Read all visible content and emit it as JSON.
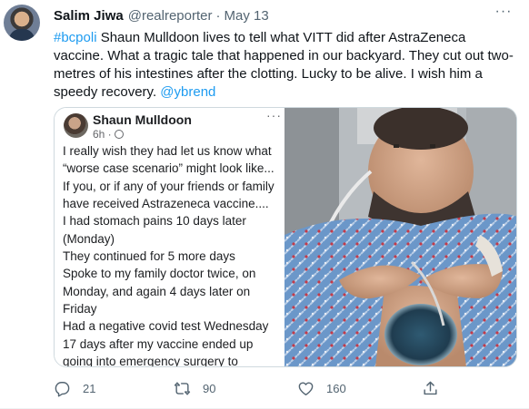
{
  "tweet": {
    "author_name": "Salim Jiwa",
    "author_handle": "@realreporter",
    "separator": "·",
    "date": "May 13",
    "more_label": "···",
    "text_hashtag": "#bcpoli",
    "text_body": " Shaun Mulldoon lives to tell what VITT did after AstraZeneca vaccine. What a tragic tale that happened in our backyard. They cut out two-metres of his intestines after the clotting. Lucky to be alive.  I wish him a speedy recovery. ",
    "text_mention": "@ybrend"
  },
  "media": {
    "post_author": "Shaun Mulldoon",
    "post_time": "6h ·",
    "post_more": "···",
    "post_lines": [
      "I really wish they had let us know what",
      "“worse case scenario” might look like...",
      "If you, or if any of your friends or family",
      "have received Astrazeneca vaccine....",
      "I had stomach pains 10 days later",
      "(Monday)",
      "They continued for 5 more days",
      "Spoke to my family doctor twice, on",
      "Monday, and again 4 days later on",
      "Friday",
      "Had a negative covid test Wednesday",
      "17 days after my vaccine ended up",
      "going into emergency surgery to"
    ]
  },
  "actions": {
    "reply_count": "21",
    "retweet_count": "90",
    "like_count": "160",
    "icons": [
      "reply-icon",
      "retweet-icon",
      "like-icon",
      "share-icon"
    ]
  },
  "colors": {
    "link": "#1d9bf0",
    "secondary_text": "#536471",
    "gown_blue": "#5f8fc4"
  }
}
